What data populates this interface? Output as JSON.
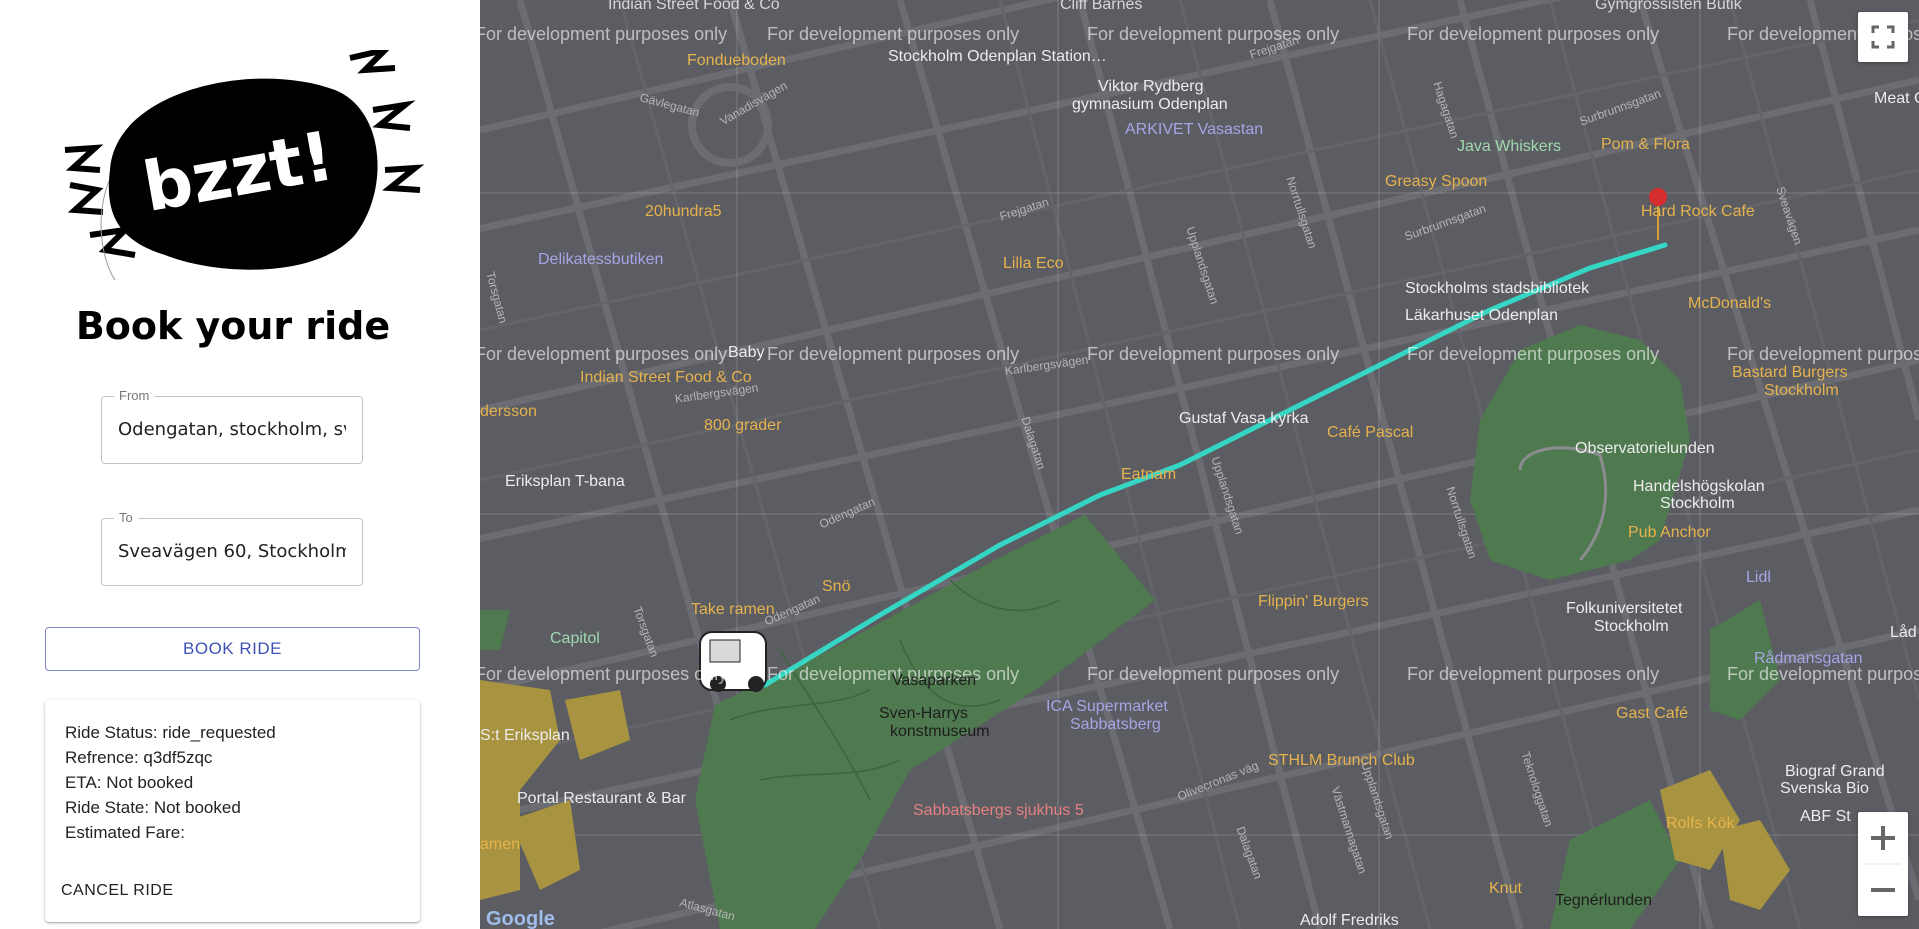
{
  "logo": {
    "text": "bzzt!"
  },
  "title": "Book your ride",
  "from": {
    "label": "From",
    "value": "Odengatan, stockholm, sv"
  },
  "to": {
    "label": "To",
    "value": "Sveavägen 60, Stockholm"
  },
  "book_button": "BOOK RIDE",
  "status": {
    "ride_status": "Ride Status: ride_requested",
    "reference": "Refrence: q3df5zqc",
    "eta": "ETA: Not booked",
    "ride_state": "Ride State: Not booked",
    "fare": "Estimated Fare:"
  },
  "cancel_button": "CANCEL RIDE",
  "map": {
    "watermark": "For development purposes only",
    "route_color": "#35d6c4",
    "poi": {
      "fondueboden": "Fondueboden",
      "odenplan_station": "Stockholm Odenplan Station…",
      "viktor": "Viktor Rydberg",
      "gymnasium": "gymnasium Odenplan",
      "arkivet": "ARKIVET Vasastan",
      "java": "Java Whiskers",
      "pom": "Pom & Flora",
      "greasy": "Greasy Spoon",
      "hard_rock": "Hard Rock Cafe",
      "hundra": "20hundra5",
      "deli": "Delikatessbutiken",
      "lilla": "Lilla Eco",
      "library": "Stockholms stadsbibliotek",
      "lakarhuset": "Läkarhuset Odenplan",
      "mcd": "McDonald's",
      "bastard": "Bastard Burgers",
      "bastard2": "Stockholm",
      "baby": "Baby",
      "indian": "Indian Street Food & Co",
      "dersson": "dersson",
      "grader": "800 grader",
      "gustaf": "Gustaf Vasa kyrka",
      "cafe_pascal": "Café Pascal",
      "obs": "Observatorielunden",
      "handel": "Handelshögskolan",
      "handel2": "Stockholm",
      "eriksplan": "Eriksplan T-bana",
      "eatnam": "Eatnam",
      "pub": "Pub Anchor",
      "lidl": "Lidl",
      "sno": "Snö",
      "take": "Take ramen",
      "flippin": "Flippin' Burgers",
      "folk": "Folkuniversitetet",
      "folk2": "Stockholm",
      "capitol": "Capitol",
      "radman": "Rådmansgatan",
      "vasaparken": "Vasaparken",
      "sven": "Sven-Harrys",
      "sven2": "konstmuseum",
      "ica": "ICA Supermarket",
      "ica2": "Sabbatsberg",
      "gast": "Gast Café",
      "st_eriksplan": "S:t Eriksplan",
      "portal": "Portal Restaurant & Bar",
      "sthlm": "STHLM Brunch Club",
      "biograf": "Biograf Grand",
      "biograf2": "Svenska Bio",
      "rolfs": "Rolfs Kök",
      "abf": "ABF St",
      "sabbats": "Sabbatsbergs sjukhus 5",
      "amen": "amen",
      "knut": "Knut",
      "tegner": "Tegnérlunden",
      "adolf": "Adolf Fredriks",
      "indian_top": "Indian Street Food & Co",
      "cliff": "Cliff Barnes",
      "gym_butik": "Gymgrossisten Butik",
      "meat": "Meat C",
      "lad": "Låd",
      "google": "Google"
    },
    "streets": {
      "odengatan": "Odengatan",
      "karlbergsvagen": "Karlbergsvägen",
      "torsgatan": "Torsgatan",
      "dalagatan": "Dalagatan",
      "upplandsgatan": "Upplandsgatan",
      "sveavagen": "Sveavägen",
      "surbrunnsgatan": "Surbrunnsgatan",
      "frejgatan": "Frejgatan",
      "hagagatan": "Hagagatan",
      "norrtullsgatan": "Norrtullsgatan",
      "vanadisvagen": "Vanadisvägen",
      "gavlegatan": "Gävlegatan",
      "atlasgatan": "Atlasgatan",
      "vastmannagatan": "Västmannagatan",
      "olivecronas": "Olivecronas väg",
      "tegnergatan": "Teknologgatan"
    }
  }
}
